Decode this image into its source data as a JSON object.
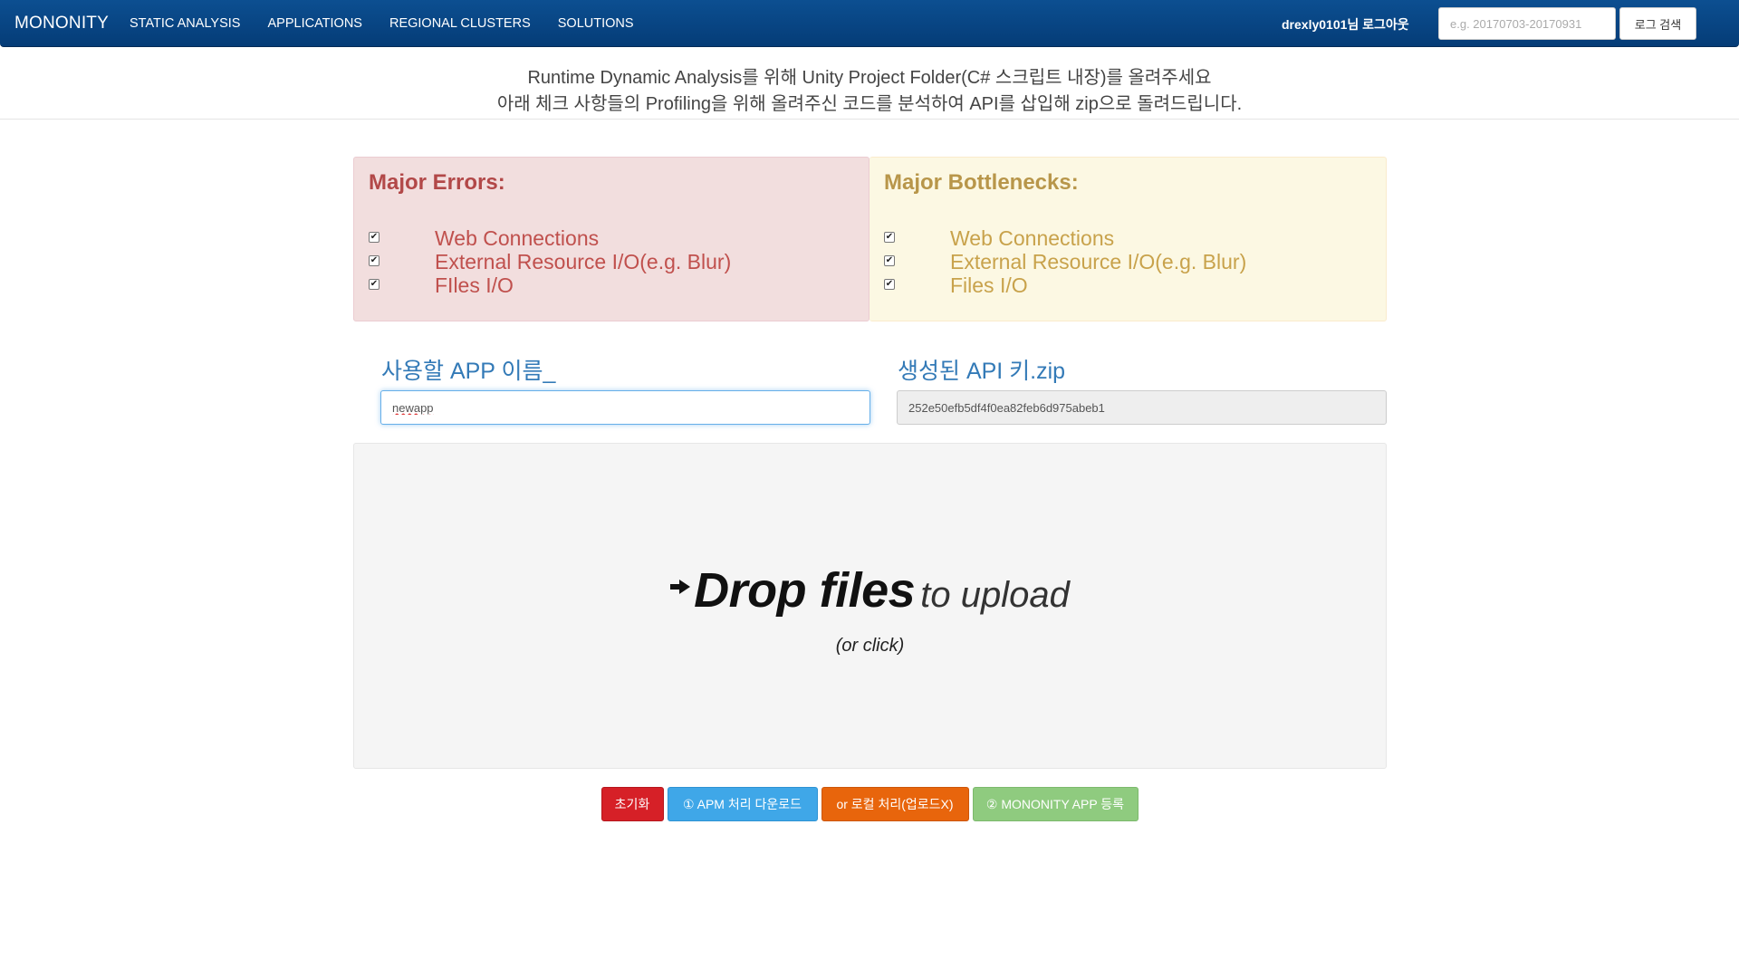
{
  "navbar": {
    "brand": "MONONITY",
    "links": [
      "STATIC ANALYSIS",
      "APPLICATIONS",
      "REGIONAL CLUSTERS",
      "SOLUTIONS"
    ],
    "user_text": "drexly0101님 로그아웃",
    "search_placeholder": "e.g. 20170703-20170931",
    "search_button": "로그 검색"
  },
  "header": {
    "line1": "Runtime Dynamic Analysis를 위해 Unity Project Folder(C# 스크립트 내장)를 올려주세요",
    "line2": "아래 체크 사항들의 Profiling을 위해 올려주신 코드를 분석하여 API를 삽입해 zip으로 돌려드립니다."
  },
  "errors_panel": {
    "title": "Major Errors:",
    "items": [
      "Web Connections",
      "External Resource I/O(e.g. Blur)",
      "FIles I/O"
    ],
    "checked": [
      true,
      true,
      true
    ]
  },
  "bottlenecks_panel": {
    "title": "Major Bottlenecks:",
    "items": [
      "Web Connections",
      "External Resource I/O(e.g. Blur)",
      "Files I/O"
    ],
    "checked": [
      true,
      true,
      true
    ]
  },
  "form": {
    "app_name_label": "사용할 APP 이름_",
    "app_name_value": "newapp",
    "api_key_label": "생성된 API 키.zip",
    "api_key_value": "252e50efb5df4f0ea82feb6d975abeb1"
  },
  "dropzone": {
    "bold_text": "Drop files",
    "light_text": "to upload",
    "sub_text": "(or click)"
  },
  "buttons": {
    "reset": "초기화",
    "apm": "① APM 처리 다운로드",
    "local": "or 로컬 처리(업로드X)",
    "register": "② MONONITY APP 등록"
  },
  "colors": {
    "navbar": "#0c4f91",
    "errors_bg": "#f2dede",
    "bottlenecks_bg": "#fcf8e3",
    "reset_btn": "#d62027",
    "apm_btn": "#3fa7e8",
    "local_btn": "#e8650c",
    "register_btn": "#8fcb7f"
  }
}
